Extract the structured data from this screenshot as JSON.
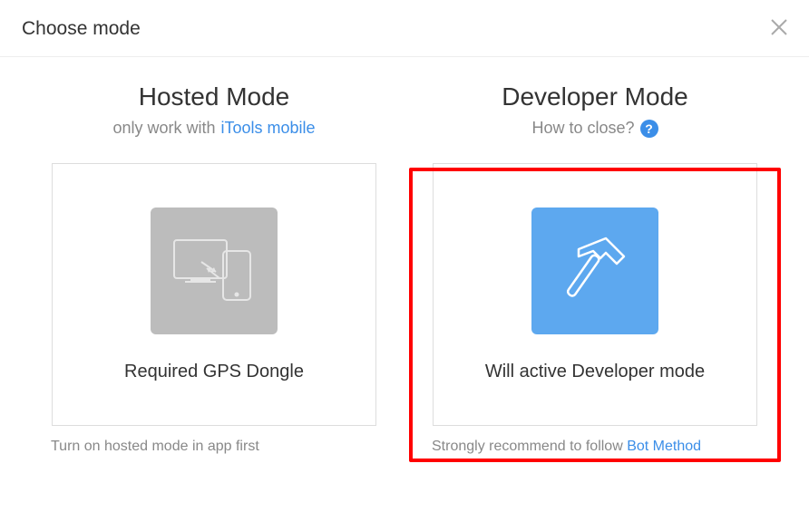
{
  "header": {
    "title": "Choose mode"
  },
  "hosted": {
    "title": "Hosted Mode",
    "subtitle_prefix": "only work with",
    "subtitle_link": "iTools mobile",
    "card_label": "Required GPS Dongle",
    "footer": "Turn on hosted mode in app first"
  },
  "developer": {
    "title": "Developer Mode",
    "subtitle_prefix": "How to close?",
    "card_label": "Will active Developer mode",
    "footer_prefix": "Strongly recommend to follow",
    "footer_link": "Bot Method"
  }
}
